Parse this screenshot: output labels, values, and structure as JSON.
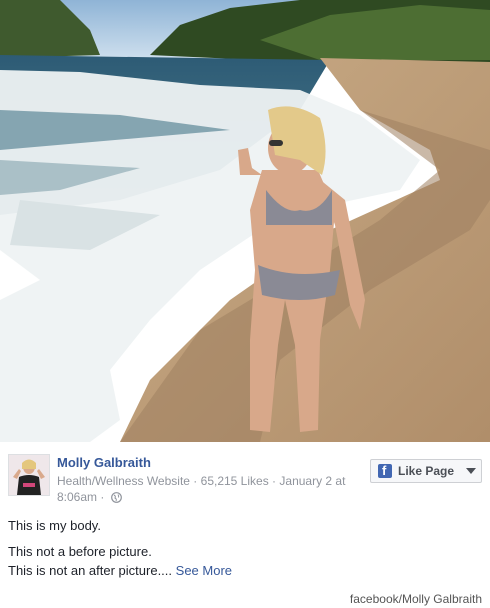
{
  "photo": {
    "description_icon": "photo-icon"
  },
  "post": {
    "page_name": "Molly Galbraith",
    "category": "Health/Wellness Website",
    "likes": "65,215 Likes",
    "date": "January 2 at",
    "time": "8:06am",
    "separator": "·",
    "privacy_icon": "globe-icon",
    "like_page_label": "Like Page",
    "like_page_icon": "facebook-icon",
    "menu_icon": "chevron-down-icon",
    "lines": [
      "This is my body.",
      "This not a before picture.",
      "This is not an after picture...."
    ],
    "see_more": "See More"
  },
  "credit": "facebook/Molly Galbraith",
  "colors": {
    "link": "#365899",
    "meta": "#90949c",
    "text": "#1d2129",
    "facebook_blue": "#4267b2"
  }
}
